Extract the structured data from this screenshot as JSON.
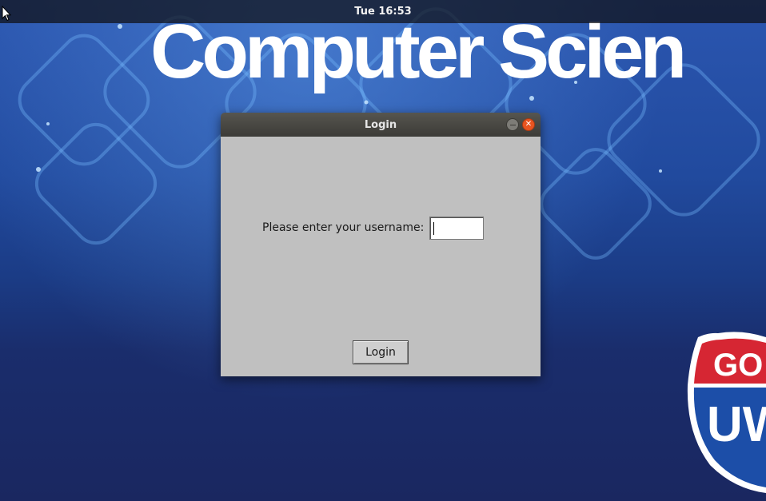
{
  "top_bar": {
    "clock": "Tue 16:53"
  },
  "wallpaper": {
    "title": "Computer Scien",
    "logo_text_top": "GO",
    "logo_text_bottom": "UW",
    "logo_colors": {
      "red": "#d62633",
      "blue": "#1c4ea8",
      "white": "#ffffff"
    }
  },
  "window": {
    "title": "Login",
    "username_label": "Please enter your username:",
    "username_value": "",
    "login_button": "Login"
  },
  "colors": {
    "window_body": "#c0c0c0",
    "titlebar": "#3c3b37",
    "close_button": "#e95420"
  },
  "icons": {
    "cursor": "mouse-pointer-icon",
    "minimize": "minimize-icon",
    "close": "close-icon"
  }
}
